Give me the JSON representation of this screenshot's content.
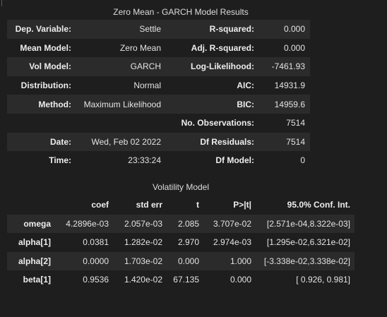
{
  "summary": {
    "title": "Zero Mean - GARCH Model Results",
    "rows": [
      {
        "l1": "Dep. Variable:",
        "v1": "Settle",
        "l2": "R-squared:",
        "v2": "0.000"
      },
      {
        "l1": "Mean Model:",
        "v1": "Zero Mean",
        "l2": "Adj. R-squared:",
        "v2": "0.000"
      },
      {
        "l1": "Vol Model:",
        "v1": "GARCH",
        "l2": "Log-Likelihood:",
        "v2": "-7461.93"
      },
      {
        "l1": "Distribution:",
        "v1": "Normal",
        "l2": "AIC:",
        "v2": "14931.9"
      },
      {
        "l1": "Method:",
        "v1": "Maximum Likelihood",
        "l2": "BIC:",
        "v2": "14959.6"
      },
      {
        "l1": "",
        "v1": "",
        "l2": "No. Observations:",
        "v2": "7514"
      },
      {
        "l1": "Date:",
        "v1": "Wed, Feb 02 2022",
        "l2": "Df Residuals:",
        "v2": "7514"
      },
      {
        "l1": "Time:",
        "v1": "23:33:24",
        "l2": "Df Model:",
        "v2": "0"
      }
    ]
  },
  "volatility": {
    "title": "Volatility Model",
    "headers": [
      "",
      "coef",
      "std err",
      "t",
      "P>|t|",
      "95.0% Conf. Int."
    ],
    "rows": [
      [
        "omega",
        "4.2896e-03",
        "2.057e-03",
        "2.085",
        "3.707e-02",
        "[2.571e-04,8.322e-03]"
      ],
      [
        "alpha[1]",
        "0.0381",
        "1.282e-02",
        "2.970",
        "2.974e-03",
        "[1.295e-02,6.321e-02]"
      ],
      [
        "alpha[2]",
        "0.0000",
        "1.703e-02",
        "0.000",
        "1.000",
        "[-3.338e-02,3.338e-02]"
      ],
      [
        "beta[1]",
        "0.9536",
        "1.420e-02",
        "67.135",
        "0.000",
        "[ 0.926, 0.981]"
      ]
    ]
  }
}
